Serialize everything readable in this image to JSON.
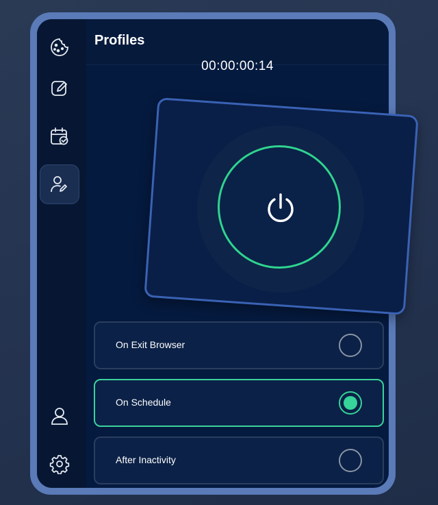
{
  "header": {
    "title": "Profiles"
  },
  "timer": {
    "elapsed": "00:00:00:14"
  },
  "sidebar": {
    "items": [
      {
        "icon": "cookie-icon",
        "active": false
      },
      {
        "icon": "edit-icon",
        "active": false
      },
      {
        "icon": "calendar-check-icon",
        "active": false
      },
      {
        "icon": "user-edit-icon",
        "active": true
      },
      {
        "icon": "user-icon",
        "active": false
      },
      {
        "icon": "gear-icon",
        "active": false
      }
    ]
  },
  "power": {
    "icon": "power-icon",
    "ring_color": "#2fd48f"
  },
  "options": [
    {
      "label": "On Exit Browser",
      "selected": false
    },
    {
      "label": "On Schedule",
      "selected": true
    },
    {
      "label": "After Inactivity",
      "selected": false
    }
  ],
  "colors": {
    "accent": "#36d49a",
    "background": "#051a3f",
    "frame": "#5a7ab8"
  }
}
